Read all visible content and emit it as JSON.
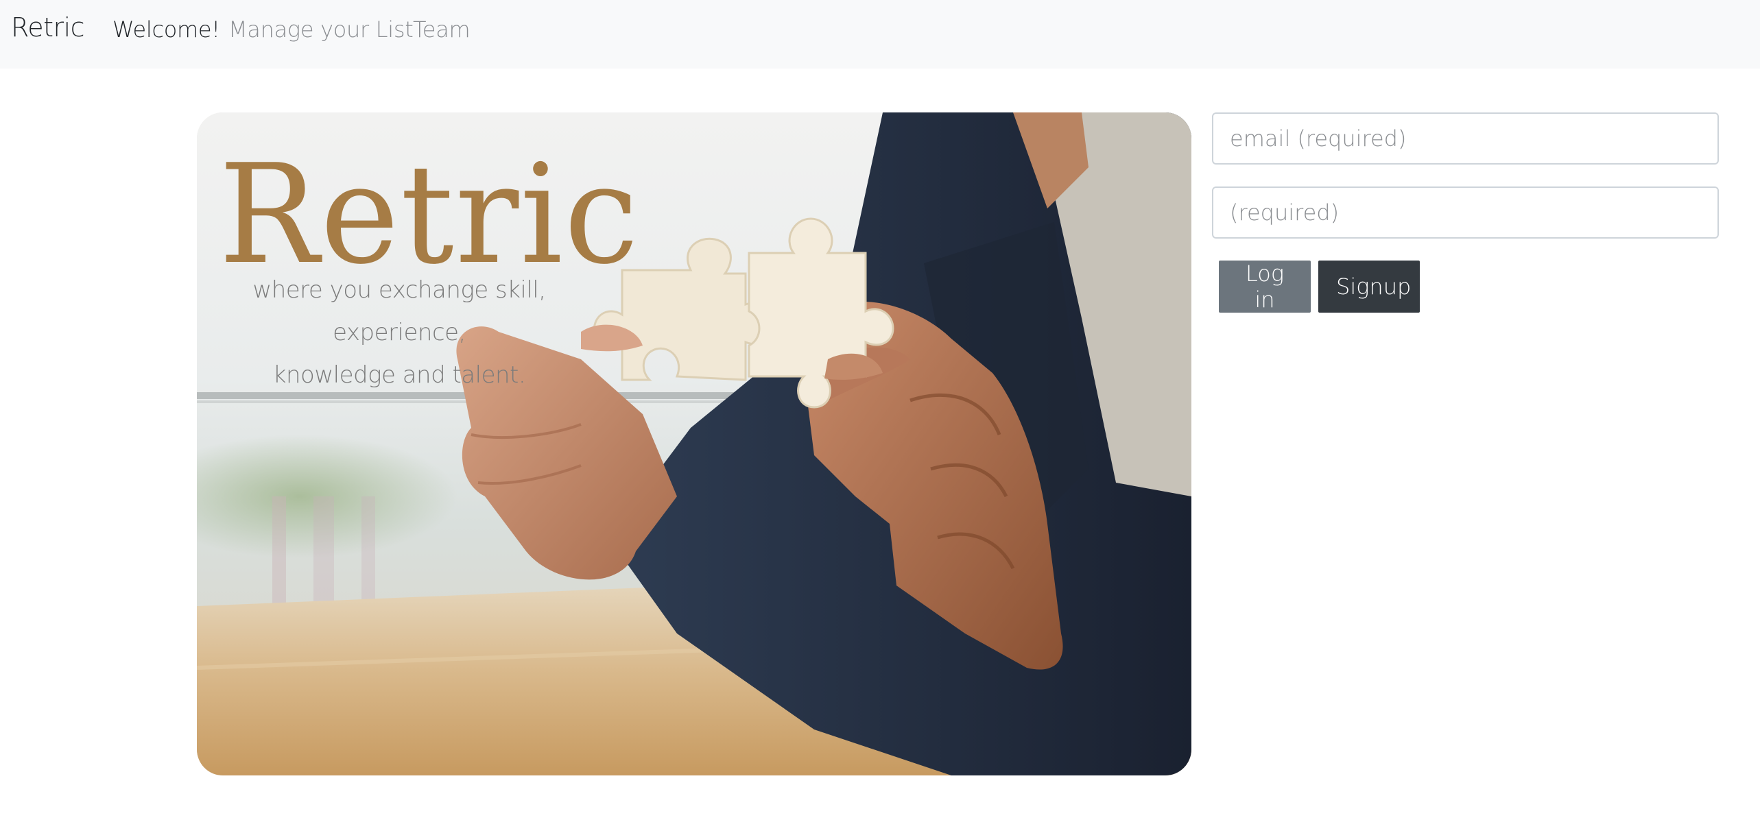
{
  "navbar": {
    "brand": "Retric",
    "links": [
      {
        "label": "Welcome!",
        "active": true
      },
      {
        "label": "Manage your List",
        "active": false
      },
      {
        "label": "Team",
        "active": false
      }
    ]
  },
  "hero": {
    "title": "Retric",
    "tagline_line1": "where you exchange skill, experience,",
    "tagline_line2": "knowledge and talent.",
    "image": "hands-holding-puzzle-pieces"
  },
  "login": {
    "email_placeholder": "email (required)",
    "password_placeholder": "(required)",
    "login_label": "Log in",
    "signup_label": "Signup"
  },
  "colors": {
    "navbar_bg": "#f8f9fa",
    "brand_accent": "#a67c45",
    "login_button": "#6c757d",
    "signup_button": "#343a40"
  }
}
